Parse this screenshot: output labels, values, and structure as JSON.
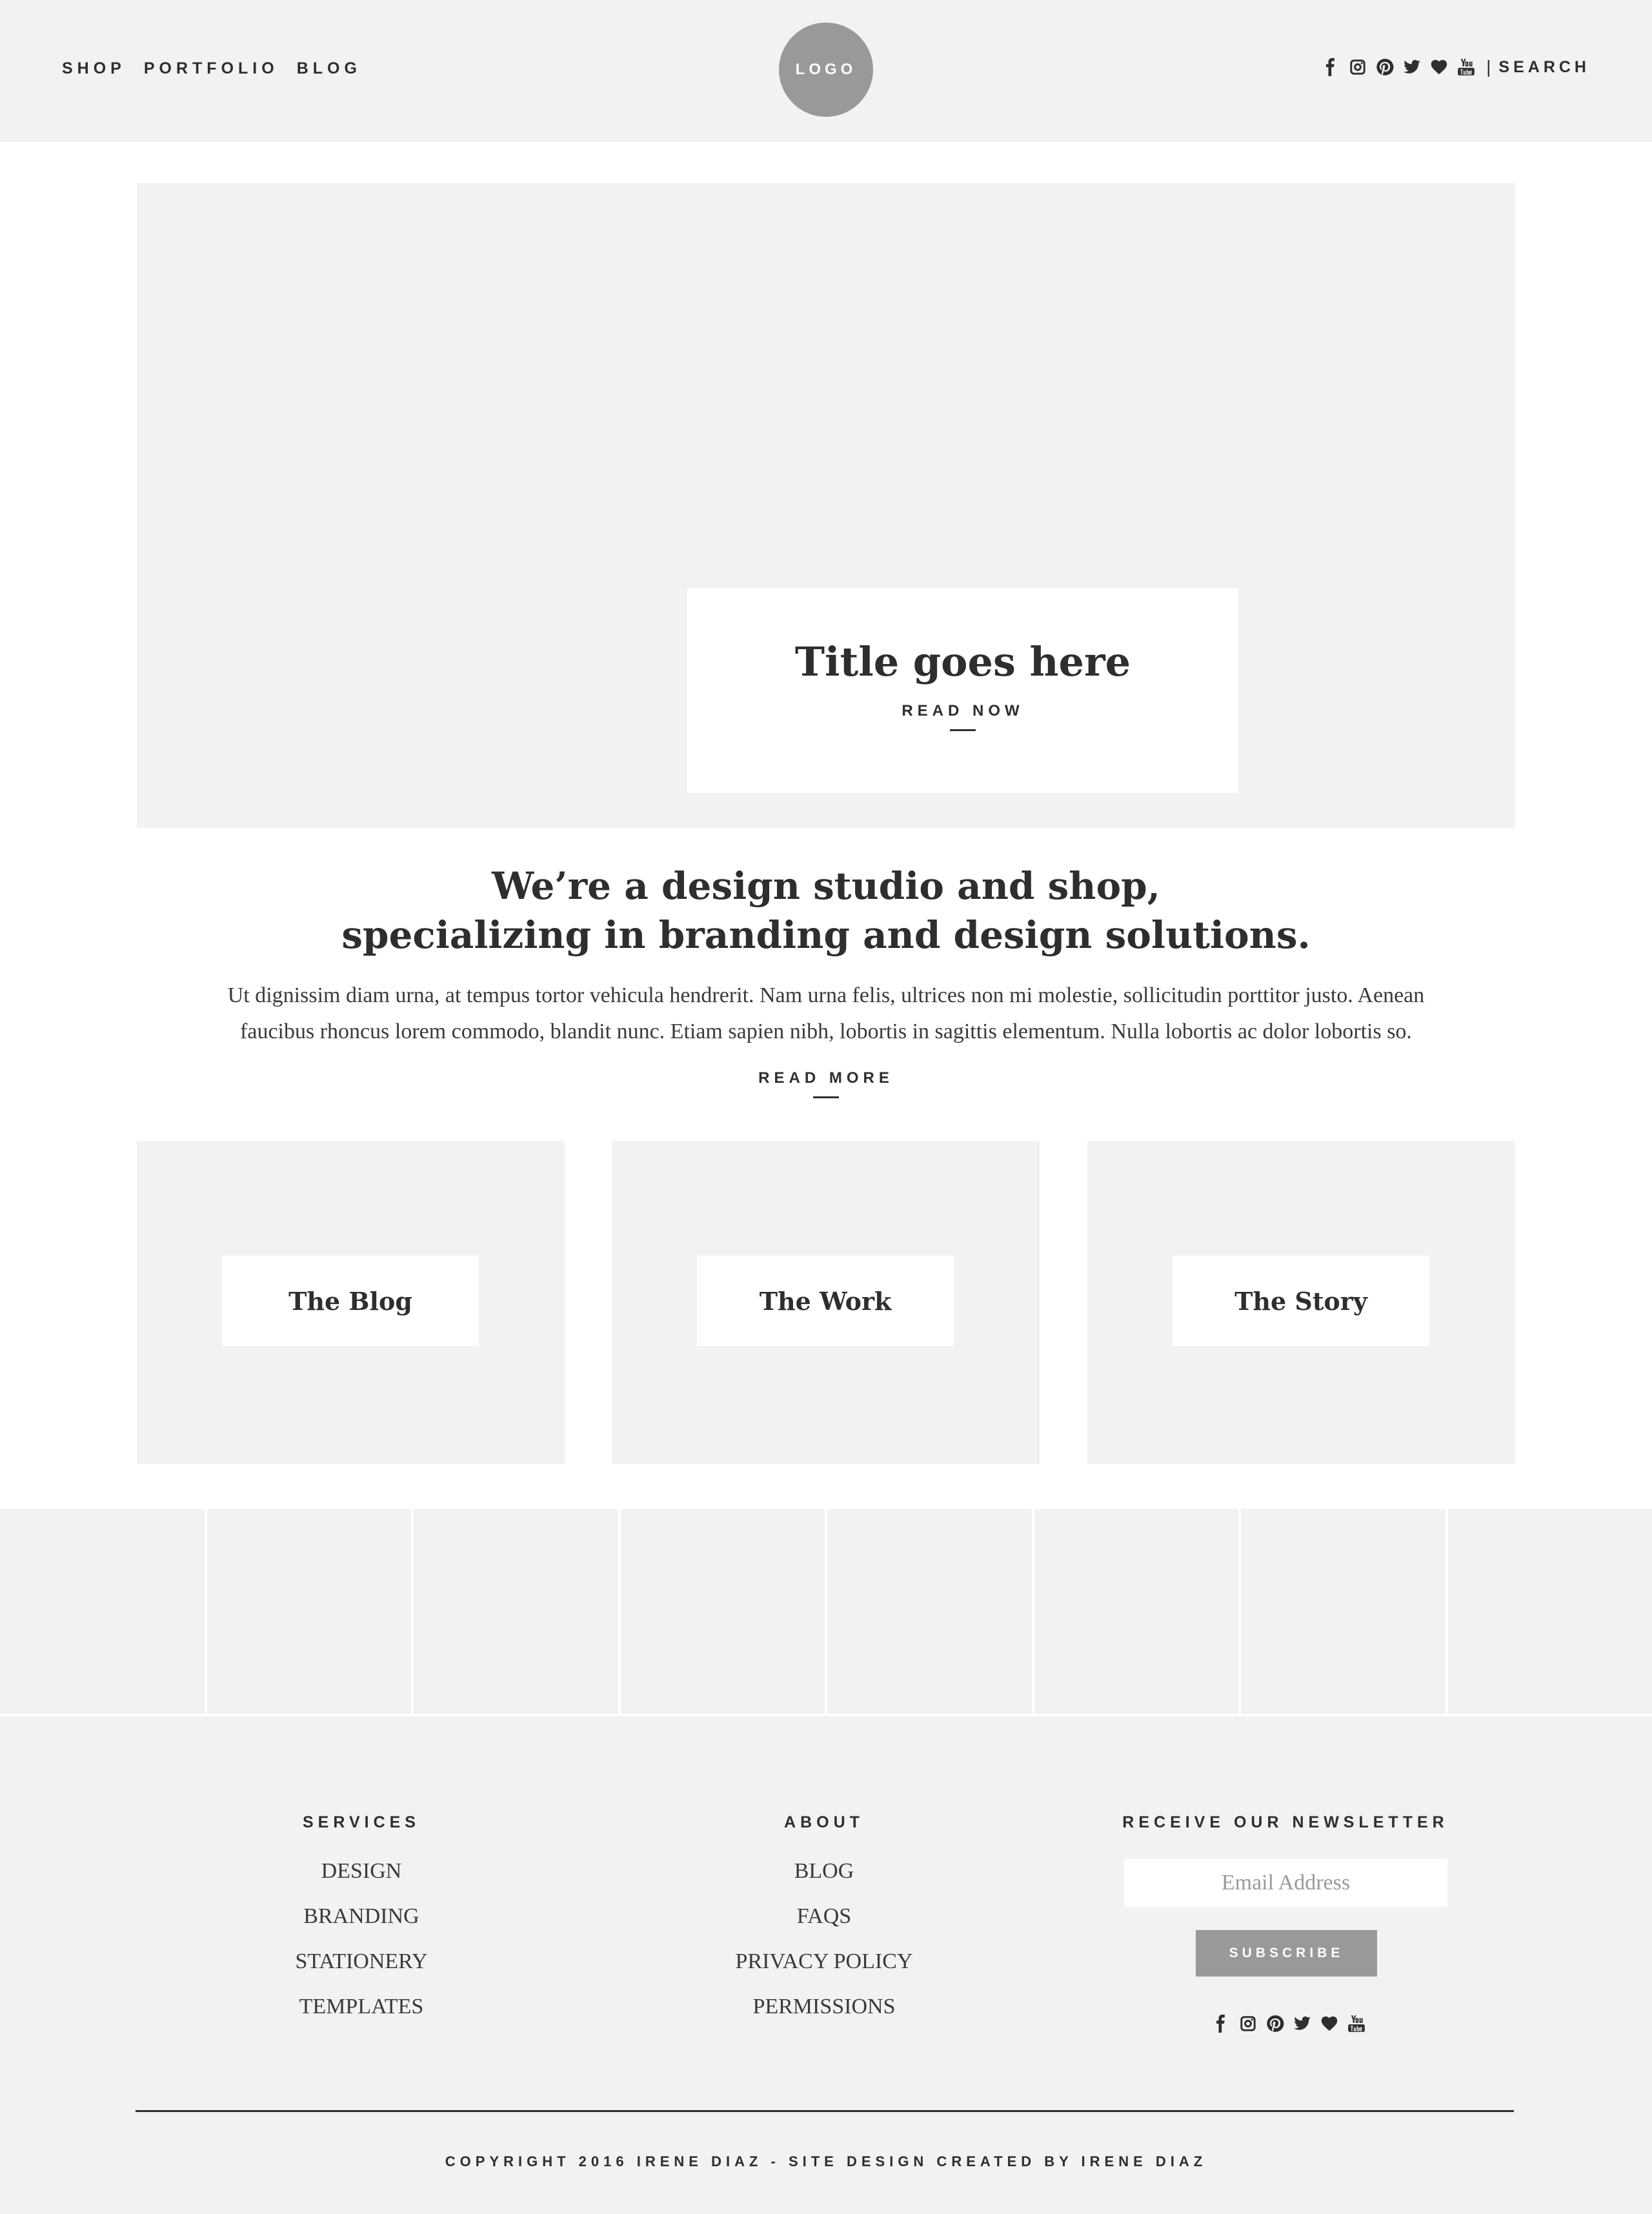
{
  "header": {
    "nav": [
      "SHOP",
      "PORTFOLIO",
      "BLOG"
    ],
    "logo_text": "LOGO",
    "social_icons": [
      "facebook-icon",
      "instagram-icon",
      "pinterest-icon",
      "twitter-icon",
      "heart-icon",
      "youtube-icon"
    ],
    "divider": "|",
    "search_label": "SEARCH"
  },
  "hero": {
    "title": "Title goes here",
    "cta": "READ NOW"
  },
  "intro": {
    "heading_line1": "We’re a design studio and shop,",
    "heading_line2": "specializing in branding and design solutions.",
    "text_line1": "Ut dignissim diam urna, at tempus tortor vehicula hendrerit. Nam urna felis, ultrices non mi molestie, sollicitudin porttitor justo. Aenean",
    "text_line2": "faucibus rhoncus lorem commodo, blandit nunc. Etiam sapien nibh, lobortis in sagittis elementum. Nulla lobortis ac dolor lobortis so.",
    "cta": "READ MORE"
  },
  "cards": [
    "The Blog",
    "The Work",
    "The Story"
  ],
  "footer": {
    "services": {
      "heading": "SERVICES",
      "links": [
        "DESIGN",
        "BRANDING",
        "STATIONERY",
        "TEMPLATES"
      ]
    },
    "about": {
      "heading": "ABOUT",
      "links": [
        "BLOG",
        "FAQS",
        "PRIVACY POLICY",
        "PERMISSIONS"
      ]
    },
    "newsletter": {
      "heading": "RECEIVE OUR NEWSLETTER",
      "placeholder": "Email Address",
      "button": "SUBSCRIBE"
    },
    "copyright": "COPYRIGHT 2016 IRENE DIAZ - SITE DESIGN CREATED BY IRENE DIAZ"
  },
  "colors": {
    "panel": "#f3f2f3",
    "text": "#2e2e2e",
    "accent_gray": "#9a9998"
  }
}
